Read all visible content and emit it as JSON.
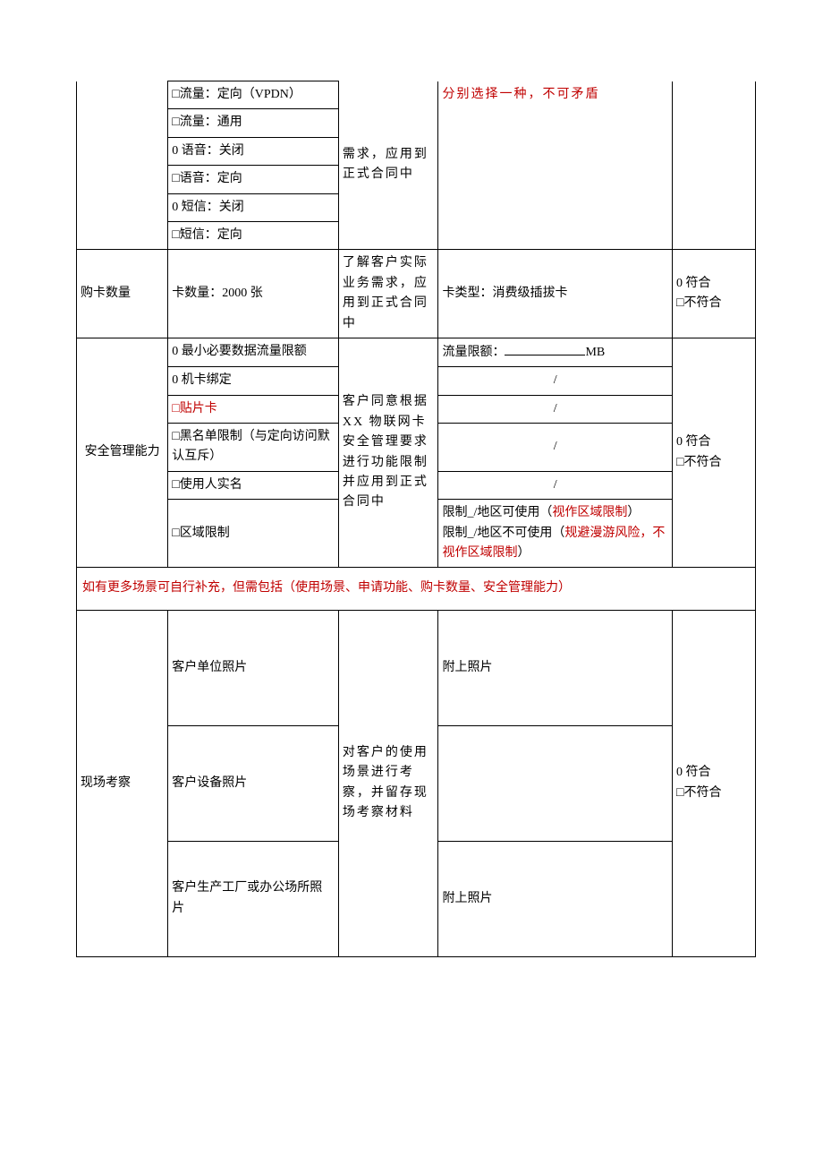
{
  "apply": {
    "opt1": "□流量：定向（VPDN）",
    "opt2": "□流量：通用",
    "opt3": "0 语音：关闭",
    "opt4": "□语音：定向",
    "opt5": "0 短信：关闭",
    "opt6": "□短信：定向",
    "purpose": "需求，应用到正式合同中",
    "note": "分别选择一种，不可矛盾"
  },
  "buy": {
    "label": "购卡数量",
    "content": "卡数量：2000 张",
    "purpose": "了解客户实际业务需求，应用到正式合同中",
    "detail": "卡类型：消费级插拔卡",
    "r1": "0 符合",
    "r2": "□不符合"
  },
  "sec": {
    "label": "安全管理能力",
    "o1": "0 最小必要数据流量限额",
    "o2": "0 机卡绑定",
    "o3": "□贴片卡",
    "o4": "□黑名单限制（与定向访问默认互斥）",
    "o5": "□使用人实名",
    "o6": "□区域限制",
    "purpose": "客户同意根据 XX 物联网卡安全管理要求进行功能限制并应用到正式合同中",
    "d1a": "流量限额：",
    "d1b": "MB",
    "d2": "/",
    "d3": "/",
    "d4": "/",
    "d5": "/",
    "d6a": "限制_/地区可使用（",
    "d6a_red": "视作区域限制",
    "d6a_end": "）",
    "d6b": "限制_/地区不可使用（",
    "d6b_red": "规避漫游风险，不视作区域限制",
    "d6b_end": "）",
    "r1": "0 符合",
    "r2": "□不符合"
  },
  "noteRow": "如有更多场景可自行补充，但需包括（使用场景、申请功能、购卡数量、安全管理能力）",
  "site": {
    "label": "现场考察",
    "p1": "客户单位照片",
    "p2": "客户设备照片",
    "p3": "客户生产工厂或办公场所照片",
    "purpose": "对客户的使用场景进行考察，并留存现场考察材料",
    "att": "附上照片",
    "r1": "0 符合",
    "r2": "□不符合"
  }
}
